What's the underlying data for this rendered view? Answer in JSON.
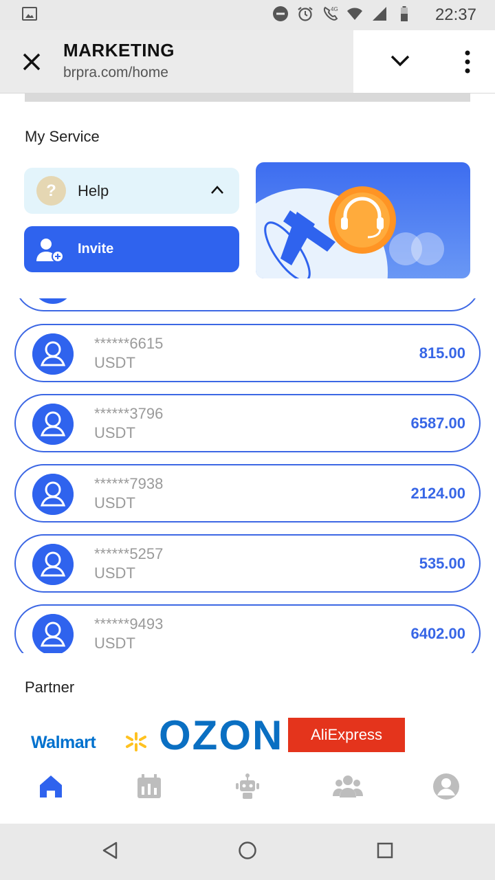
{
  "status_bar": {
    "time": "22:37",
    "network": "4G",
    "icons": [
      "gallery-icon",
      "do-not-disturb-icon",
      "alarm-icon",
      "wifi-call-icon",
      "wifi-icon",
      "signal-icon",
      "battery-icon"
    ]
  },
  "browser": {
    "title": "MARKETING",
    "url": "brpra.com/home",
    "close_icon": "close-icon",
    "dropdown_icon": "chevron-down-icon",
    "menu_icon": "more-vert-icon"
  },
  "service": {
    "heading": "My Service",
    "help_label": "Help",
    "help_icon_glyph": "?",
    "invite_label": "Invite"
  },
  "records": [
    {
      "account": "******6615",
      "unit": "USDT",
      "amount": "815.00"
    },
    {
      "account": "******3796",
      "unit": "USDT",
      "amount": "6587.00"
    },
    {
      "account": "******7938",
      "unit": "USDT",
      "amount": "2124.00"
    },
    {
      "account": "******5257",
      "unit": "USDT",
      "amount": "535.00"
    },
    {
      "account": "******9493",
      "unit": "USDT",
      "amount": "6402.00"
    }
  ],
  "partner": {
    "heading": "Partner",
    "logos": [
      "Walmart",
      "OZON",
      "AliExpress"
    ]
  },
  "tabs": [
    "home-icon",
    "calendar-icon",
    "robot-icon",
    "team-icon",
    "profile-icon"
  ],
  "colors": {
    "accent": "#2f63ee",
    "amount": "#3766e6",
    "help_bg": "#e3f4fb",
    "tab_active": "#2f63ee",
    "tab_inactive": "#bdbdbd"
  }
}
